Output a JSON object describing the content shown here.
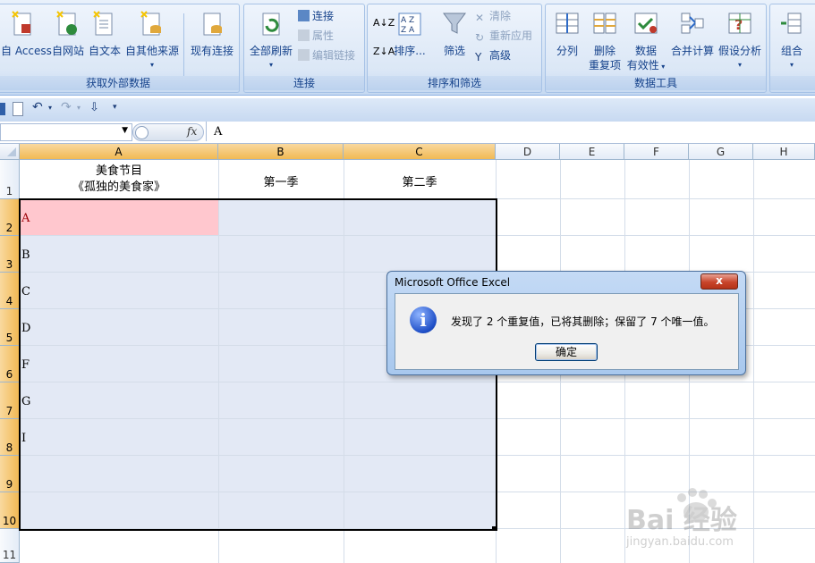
{
  "ribbon": {
    "groups": [
      {
        "label": "获取外部数据"
      },
      {
        "label": "连接"
      },
      {
        "label": "排序和筛选"
      },
      {
        "label": "数据工具"
      }
    ],
    "buttons": {
      "from_access": "自 Access",
      "from_web": "自网站",
      "from_text": "自文本",
      "from_other": "自其他来源",
      "existing_connections": "现有连接",
      "refresh_all": "全部刷新",
      "connections": "连接",
      "properties": "属性",
      "edit_links": "编辑链接",
      "sort": "排序...",
      "filter": "筛选",
      "clear": "清除",
      "reapply": "重新应用",
      "advanced": "高级",
      "text_to_columns": "分列",
      "remove_dup_1": "删除",
      "remove_dup_2": "重复项",
      "validation_1": "数据",
      "validation_2": "有效性",
      "consolidate": "合并计算",
      "whatif": "假设分析",
      "group": "组合"
    }
  },
  "formula_bar": {
    "fx": "fx",
    "value": "A"
  },
  "columns": [
    "A",
    "B",
    "C",
    "D",
    "E",
    "F",
    "G",
    "H"
  ],
  "rows": [
    "1",
    "2",
    "3",
    "4",
    "5",
    "6",
    "7",
    "8",
    "9",
    "10",
    "11"
  ],
  "cells": {
    "a1_line1": "美食节目",
    "a1_line2": "《孤独的美食家》",
    "b1": "第一季",
    "c1": "第二季",
    "a_values": [
      "A",
      "B",
      "C",
      "D",
      "F",
      "G",
      "I"
    ]
  },
  "dialog": {
    "title": "Microsoft Office Excel",
    "close": "x",
    "message": "发现了 2 个重复值，已将其删除；保留了 7 个唯一值。",
    "ok": "确定"
  },
  "watermark": {
    "brand": "Bai 经验",
    "url": "jingyan.baidu.com"
  },
  "colors": {
    "highlight": "#ffc7ce",
    "selection": "#e3e9f5",
    "header_selected": "#f1b954"
  }
}
